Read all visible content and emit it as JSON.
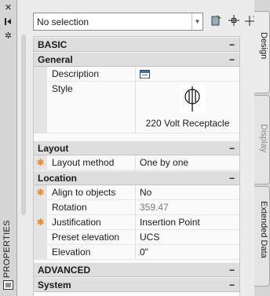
{
  "palette": {
    "title_strip": "#d6d6d6",
    "panel_bg": "#ececec",
    "category_bg": "#dedede",
    "gutter_bg": "#e4e4e4",
    "modified_marker": "#e88a2a"
  },
  "title_strip": {
    "title": "PROPERTIES",
    "icons": [
      "close-icon",
      "auto-hide-icon",
      "settings-icon",
      "properties-icon"
    ]
  },
  "toolbar": {
    "selection_value": "No selection",
    "icons": [
      "quick-select-icon",
      "select-objects-icon",
      "toggle-pickadd-icon"
    ]
  },
  "tabs": [
    "Design",
    "Display",
    "Extended Data"
  ],
  "grid": {
    "basic": {
      "label": "BASIC",
      "toggle": "−"
    },
    "general": {
      "label": "General",
      "toggle": "−"
    },
    "description": {
      "label": "Description"
    },
    "style": {
      "label": "Style",
      "caption": "220 Volt Receptacle"
    },
    "layout": {
      "label": "Layout",
      "toggle": "−"
    },
    "layout_method": {
      "label": "Layout method",
      "value": "One by one",
      "marker": "✱"
    },
    "location": {
      "label": "Location",
      "toggle": "−"
    },
    "align_to_objects": {
      "label": "Align to objects",
      "value": "No",
      "marker": "✱"
    },
    "rotation": {
      "label": "Rotation",
      "value": "359.47"
    },
    "justification": {
      "label": "Justification",
      "value": "Insertion Point",
      "marker": "✱"
    },
    "preset_elevation": {
      "label": "Preset elevation",
      "value": "UCS"
    },
    "elevation": {
      "label": "Elevation",
      "value": "0\""
    },
    "advanced": {
      "label": "ADVANCED",
      "toggle": "−"
    },
    "system": {
      "label": "System",
      "toggle": "−"
    }
  }
}
